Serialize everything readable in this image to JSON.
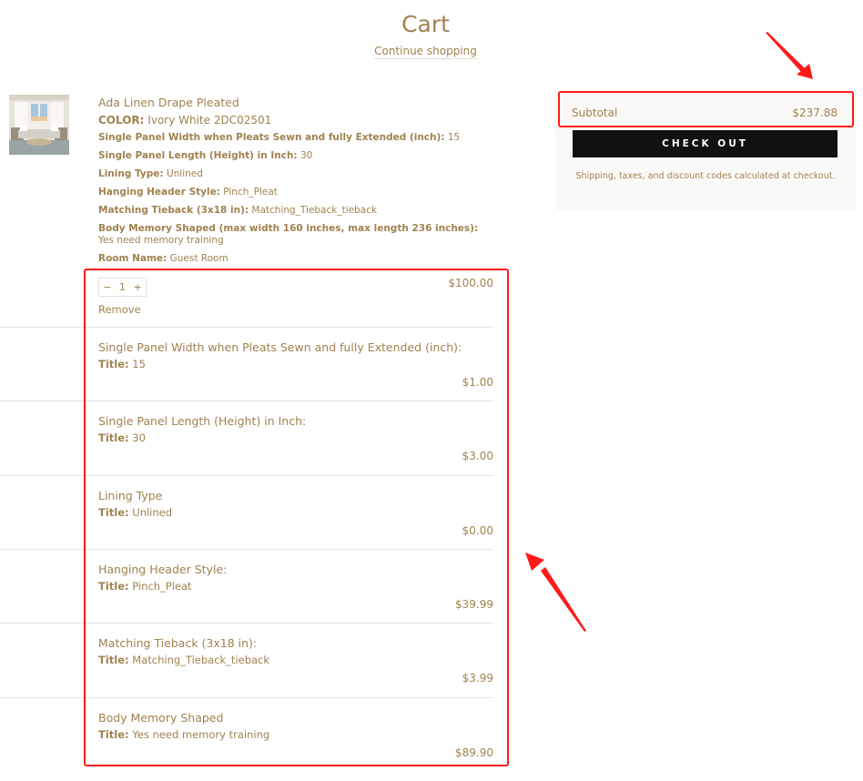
{
  "header": {
    "title": "Cart",
    "continue_label": "Continue shopping"
  },
  "item": {
    "image_alt": "Living room with linen drapes",
    "name": "Ada Linen Drape Pleated",
    "color_label": "COLOR:",
    "color_value": "Ivory White 2DC02501",
    "properties": [
      {
        "label": "Single Panel Width when Pleats Sewn and fully Extended (inch):",
        "value": "15"
      },
      {
        "label": "Single Panel Length (Height) in Inch:",
        "value": "30"
      },
      {
        "label": "Lining Type:",
        "value": "Unlined"
      },
      {
        "label": "Hanging Header Style:",
        "value": "Pinch_Pleat"
      },
      {
        "label": "Matching Tieback  (3x18 in):",
        "value": "Matching_Tieback_tieback"
      },
      {
        "label": "Body Memory Shaped (max width 160 inches, max length 236 inches):",
        "value": "Yes need memory training"
      },
      {
        "label": "Room Name:",
        "value": "Guest Room"
      }
    ],
    "quantity": {
      "minus": "−",
      "value": "1",
      "plus": "+"
    },
    "remove_label": "Remove",
    "price": "$100.00"
  },
  "addons": [
    {
      "name": "Single Panel Width when Pleats Sewn and fully Extended (inch):",
      "title_label": "Title:",
      "title_value": "15",
      "price": "$1.00"
    },
    {
      "name": "Single Panel Length (Height) in Inch:",
      "title_label": "Title:",
      "title_value": "30",
      "price": "$3.00"
    },
    {
      "name": "Lining Type",
      "title_label": "Title:",
      "title_value": "Unlined",
      "price": "$0.00"
    },
    {
      "name": "Hanging Header Style:",
      "title_label": "Title:",
      "title_value": "Pinch_Pleat",
      "price": "$39.99"
    },
    {
      "name": "Matching Tieback  (3x18 in):",
      "title_label": "Title:",
      "title_value": "Matching_Tieback_tieback",
      "price": "$3.99"
    },
    {
      "name": "Body Memory Shaped",
      "title_label": "Title:",
      "title_value": "Yes need memory training",
      "price": "$89.90"
    }
  ],
  "summary": {
    "subtotal_label": "Subtotal",
    "subtotal_value": "$237.88",
    "checkout_label": "CHECK OUT",
    "note": "Shipping, taxes, and discount codes calculated at checkout."
  },
  "colors": {
    "text": "#a08250",
    "checkout_bg": "#111111",
    "summary_bg": "#fbf9f7",
    "annotation": "#ff1a1a"
  }
}
